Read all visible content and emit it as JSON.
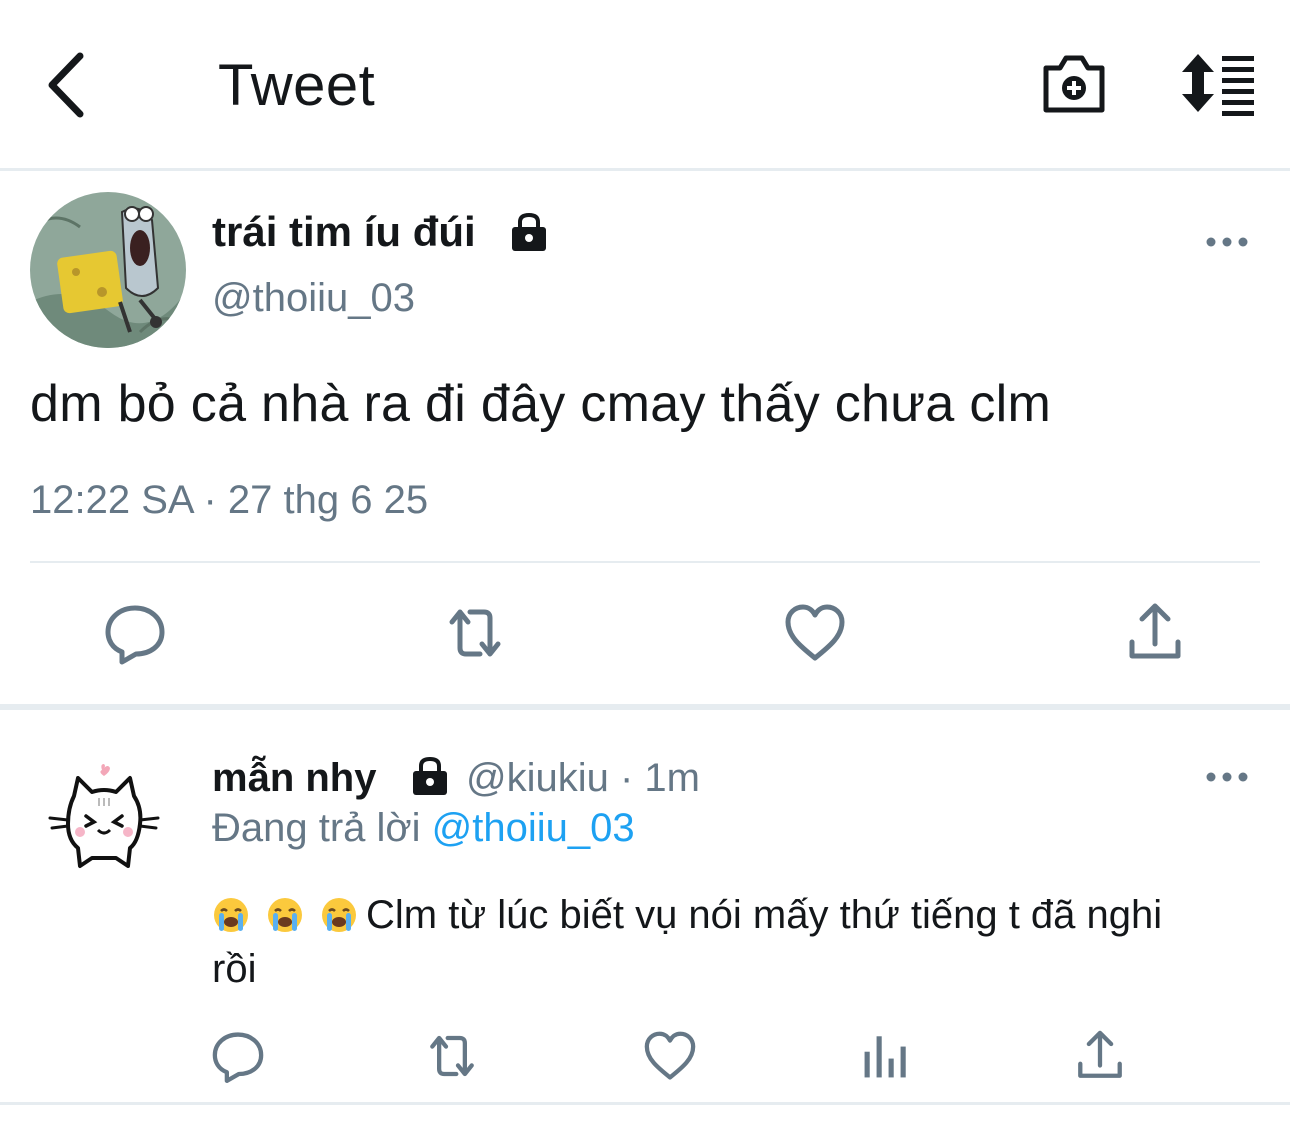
{
  "header": {
    "title": "Tweet"
  },
  "tweet": {
    "display_name": "trái tim íu đúi",
    "handle": "@thoiiu_03",
    "text": "dm bỏ cả nhà ra đi đây cmay thấy chưa clm",
    "timestamp": "12:22 SA · 27 thg 6 25"
  },
  "reply": {
    "display_name": "mẫn nhy",
    "meta": "@kiukiu · 1m",
    "replying_prefix": "Đang trả lời",
    "replying_to": "@thoiiu_03",
    "text": "Clm từ lúc biết vụ nói mấy thứ tiếng t đã nghi rồi"
  },
  "icons": {
    "header": [
      "back-icon",
      "camera-plus-icon",
      "sort-icon"
    ],
    "tweet_actions": [
      "reply-icon",
      "retweet-icon",
      "like-icon",
      "share-icon"
    ],
    "reply_actions": [
      "reply-icon",
      "retweet-icon",
      "like-icon",
      "analytics-icon",
      "share-icon"
    ],
    "emoji": "loudly-crying-face"
  },
  "colors": {
    "secondary_text": "#657786",
    "mention": "#1da1f2",
    "icon": "#657786",
    "divider": "#e6ecf0"
  }
}
